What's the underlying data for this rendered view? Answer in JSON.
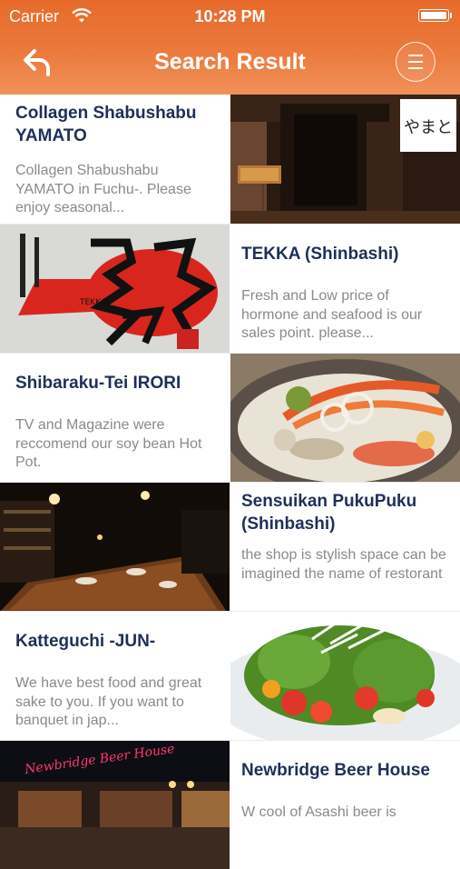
{
  "status_bar": {
    "carrier": "Carrier",
    "time": "10:28 PM"
  },
  "header": {
    "title": "Search Result"
  },
  "icons": {
    "back": "back-arrow-icon",
    "menu": "hamburger-menu-icon",
    "wifi": "wifi-icon",
    "battery": "battery-icon"
  },
  "colors": {
    "header_top": "#e76a2a",
    "header_bottom": "#f0915a",
    "name_text": "#1e2f5a",
    "desc_text": "#8a8a8a"
  },
  "results": [
    {
      "name": "Collagen Shabushabu YAMATO",
      "description": "Collagen Shabushabu YAMATO in Fuchu-. Please enjoy seasonal...",
      "image_side": "right",
      "image_logo_text": "やまと"
    },
    {
      "name": "TEKKA (Shinbashi)",
      "description": "Fresh and Low price of hormone and seafood is our sales point. please...",
      "image_side": "left",
      "image_logo_text": "TEKKA"
    },
    {
      "name": "Shibaraku-Tei  IRORI",
      "description": "TV and Magazine were reccomend our soy bean Hot Pot.",
      "image_side": "right"
    },
    {
      "name": "Sensuikan PukuPuku (Shinbashi)",
      "description": "the shop is stylish space can be imagined the name of restorant",
      "image_side": "left"
    },
    {
      "name": "Katteguchi -JUN-",
      "description": "We have best food and great sake to you. If you want to banquet in jap...",
      "image_side": "right"
    },
    {
      "name": "Newbridge Beer House",
      "description": "W cool of Asashi beer is",
      "image_side": "left",
      "image_logo_text": "Newbridge Beer House"
    }
  ]
}
